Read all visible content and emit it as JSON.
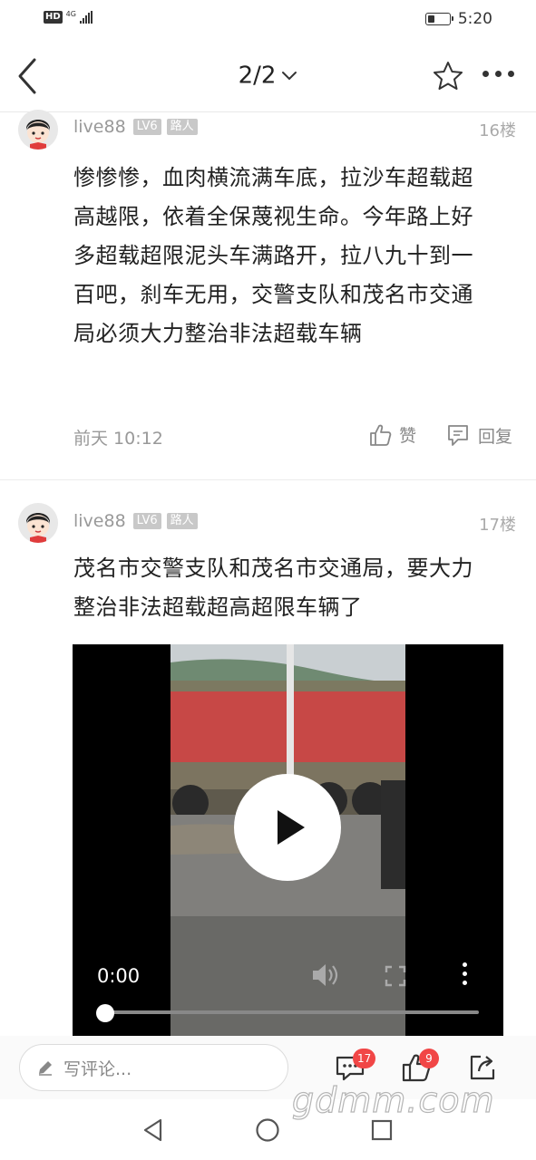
{
  "status_bar": {
    "hd": "HD",
    "network": "4G",
    "time": "5:20",
    "battery_level": 0.3
  },
  "nav": {
    "page_indicator": "2/2"
  },
  "posts": [
    {
      "username": "live88",
      "level": "LV6",
      "role": "路人",
      "floor": "16楼",
      "content": "惨惨惨，血肉横流满车底，拉沙车超载超高越限，依着全保蔑视生命。今年路上好多超载超限泥头车满路开，拉八九十到一百吧，刹车无用，交警支队和茂名市交通局必须大力整治非法超载车辆",
      "time": "前天 10:12",
      "like_label": "赞",
      "reply_label": "回复"
    },
    {
      "username": "live88",
      "level": "LV6",
      "role": "路人",
      "floor": "17楼",
      "content": "茂名市交警支队和茂名市交通局，要大力整治非法超载超高超限车辆了",
      "video": {
        "current_time": "0:00",
        "progress": 0.0
      }
    }
  ],
  "bottom_bar": {
    "comment_placeholder": "写评论...",
    "comment_count": "17",
    "like_count": "9"
  },
  "watermark": "gdmm.com",
  "colors": {
    "badge": "#f14646",
    "tag_bg": "#c8c8c8",
    "text_secondary": "#999999"
  }
}
